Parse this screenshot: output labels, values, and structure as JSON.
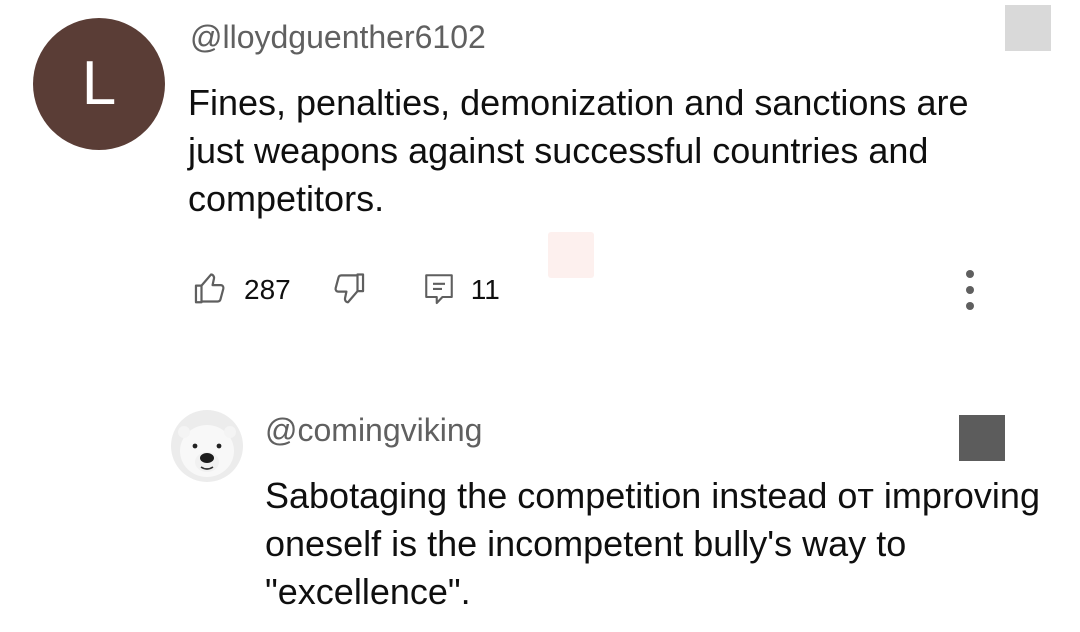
{
  "comment": {
    "avatar_letter": "L",
    "avatar_color": "#5a3d36",
    "author": "@lloydguenther6102",
    "text": "Fines, penalties, demonization and sanctions are just weapons against successful countries and competitors.",
    "like_count": "287",
    "reply_count": "11",
    "icons": [
      "thumbs-up-icon",
      "thumbs-down-icon",
      "reply-icon",
      "more-vert-icon"
    ]
  },
  "reply": {
    "author": "@comingviking",
    "avatar": "polar-bear-avatar",
    "text": "Sabotaging the competition instead oт improving oneself is the incompetent bully's way to \"excellence\"."
  },
  "colors": {
    "text_primary": "#0f0f0f",
    "text_secondary": "#606060",
    "icon": "#5f5f5f",
    "square_light": "#d9d9d9",
    "square_dark": "#5c5c5c",
    "faint_patch": "#fdf0ee"
  }
}
